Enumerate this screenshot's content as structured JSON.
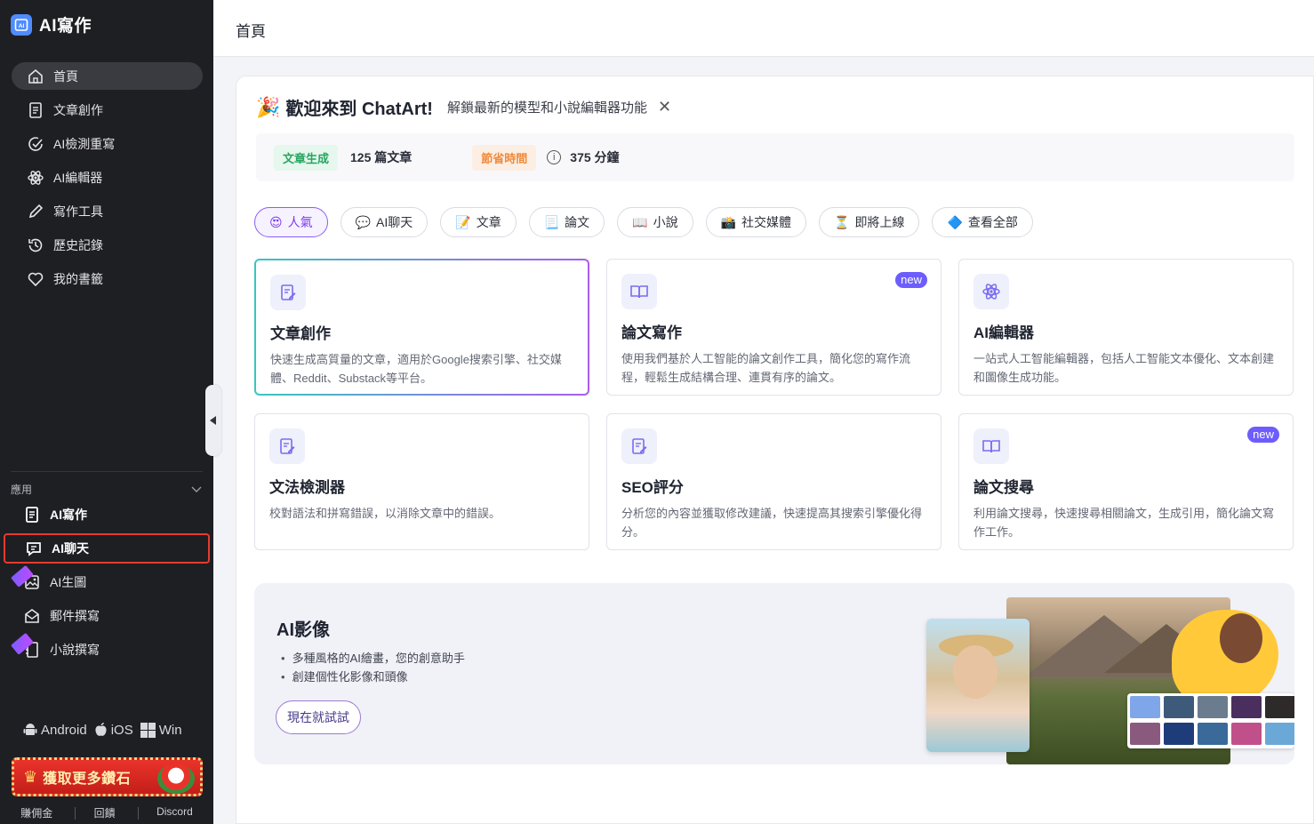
{
  "app": {
    "title": "AI寫作"
  },
  "sidebar": {
    "nav": [
      {
        "label": "首頁",
        "icon": "home-icon"
      },
      {
        "label": "文章創作",
        "icon": "document-icon"
      },
      {
        "label": "AI檢測重寫",
        "icon": "check-circle-icon"
      },
      {
        "label": "AI編輯器",
        "icon": "atom-icon"
      },
      {
        "label": "寫作工具",
        "icon": "pencil-icon"
      },
      {
        "label": "歷史記錄",
        "icon": "history-icon"
      },
      {
        "label": "我的書籤",
        "icon": "heart-icon"
      }
    ],
    "apps_header": "應用",
    "apps": [
      {
        "label": "AI寫作",
        "icon": "writing-app-icon"
      },
      {
        "label": "AI聊天",
        "icon": "chat-icon"
      },
      {
        "label": "AI生圖",
        "icon": "image-icon"
      },
      {
        "label": "郵件撰寫",
        "icon": "mail-icon"
      },
      {
        "label": "小說撰寫",
        "icon": "book-icon"
      }
    ],
    "platforms": [
      "Android",
      "iOS",
      "Win"
    ],
    "promo_banner": "獲取更多鑽石",
    "footer_links": [
      "賺佣金",
      "回饋",
      "Discord"
    ]
  },
  "topbar": {
    "title": "首頁"
  },
  "welcome": {
    "title": "歡迎來到 ChatArt!",
    "subtitle": "解鎖最新的模型和小說編輯器功能",
    "close": "✕"
  },
  "stats": {
    "generated_label": "文章生成",
    "generated_value": "125 篇文章",
    "saved_label": "節省時間",
    "saved_value": "375 分鐘"
  },
  "tabs": [
    {
      "label": "人氣",
      "emoji": "😍"
    },
    {
      "label": "AI聊天",
      "emoji": "💬"
    },
    {
      "label": "文章",
      "emoji": "📝"
    },
    {
      "label": "論文",
      "emoji": "📃"
    },
    {
      "label": "小說",
      "emoji": "📖"
    },
    {
      "label": "社交媒體",
      "emoji": "📸"
    },
    {
      "label": "即將上線",
      "emoji": "⏳"
    },
    {
      "label": "查看全部",
      "emoji": "🔷"
    }
  ],
  "cards": [
    {
      "title": "文章創作",
      "desc": "快速生成高質量的文章，適用於Google搜索引擎、社交媒體、Reddit、Substack等平台。",
      "badge": ""
    },
    {
      "title": "論文寫作",
      "desc": "使用我們基於人工智能的論文創作工具，簡化您的寫作流程，輕鬆生成結構合理、連貫有序的論文。",
      "badge": "new"
    },
    {
      "title": "AI編輯器",
      "desc": "一站式人工智能編輯器，包括人工智能文本優化、文本創建和圖像生成功能。",
      "badge": ""
    },
    {
      "title": "文法檢測器",
      "desc": "校對語法和拼寫錯誤，以消除文章中的錯誤。",
      "badge": ""
    },
    {
      "title": "SEO評分",
      "desc": "分析您的內容並獲取修改建議，快速提高其搜索引擎優化得分。",
      "badge": ""
    },
    {
      "title": "論文搜尋",
      "desc": "利用論文搜尋，快速搜尋相關論文，生成引用，簡化論文寫作工作。",
      "badge": "new"
    }
  ],
  "promo": {
    "title": "AI影像",
    "bullets": [
      "多種風格的AI繪畫，您的創意助手",
      "創建個性化影像和頭像"
    ],
    "button": "現在就試試"
  },
  "colors": {
    "accent": "#7c3aed",
    "sidebar_bg": "#1e1f23",
    "highlight": "#e53b2f",
    "new_badge": "#6d5dfc"
  }
}
